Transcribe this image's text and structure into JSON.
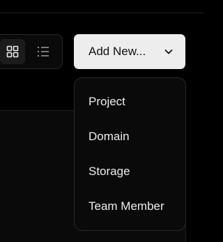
{
  "toolbar": {
    "add_new_label": "Add New...",
    "view_grid_icon": "grid-icon",
    "view_list_icon": "list-icon",
    "chevron_icon": "chevron-down-icon"
  },
  "add_new_menu": {
    "items": [
      {
        "label": "Project"
      },
      {
        "label": "Domain"
      },
      {
        "label": "Storage"
      },
      {
        "label": "Team Member"
      }
    ]
  },
  "colors": {
    "background": "#000000",
    "button_bg": "#ededed",
    "menu_bg": "#0a0a0a",
    "menu_border": "#2a2a2a",
    "text_light": "#ededed",
    "text_dark": "#111111"
  }
}
